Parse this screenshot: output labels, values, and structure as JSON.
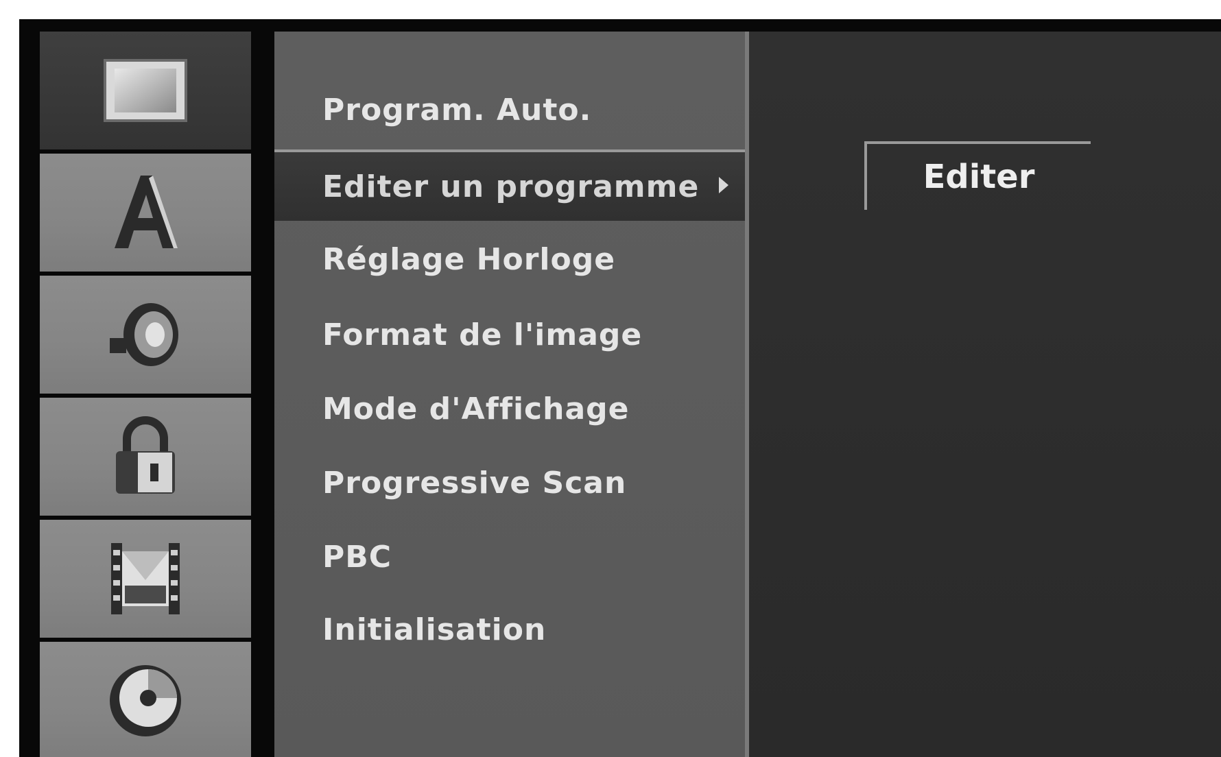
{
  "sidebar": {
    "icons": [
      {
        "name": "picture-icon",
        "selected": true
      },
      {
        "name": "language-icon",
        "glyph": "A",
        "selected": false
      },
      {
        "name": "speaker-icon",
        "selected": false
      },
      {
        "name": "lock-icon",
        "selected": false
      },
      {
        "name": "film-icon",
        "selected": false
      },
      {
        "name": "disc-icon",
        "selected": false
      }
    ]
  },
  "menu": {
    "items": [
      {
        "label": "Program. Auto."
      },
      {
        "label": "Editer un programme",
        "selected": true
      },
      {
        "label": "Réglage Horloge"
      },
      {
        "label": "Format de l'image"
      },
      {
        "label": "Mode d'Affichage"
      },
      {
        "label": "Progressive Scan"
      },
      {
        "label": "PBC"
      },
      {
        "label": "Initialisation"
      }
    ]
  },
  "submenu": {
    "button_label": "Editer"
  },
  "colors": {
    "frame": "#080808",
    "icon_tile": "#858585",
    "icon_tile_selected": "#383838",
    "menu_bg": "#5c5c5c",
    "menu_selected": "#343434",
    "submenu_bg": "#2d2d2d",
    "text": "#e6e6e6"
  }
}
